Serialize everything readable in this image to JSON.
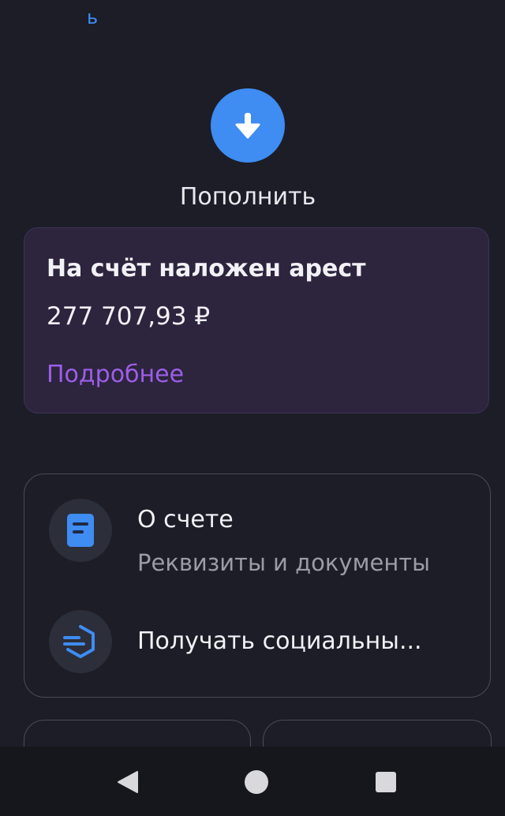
{
  "header": {
    "fragment_text": "ь"
  },
  "topup": {
    "icon": "arrow-down-icon",
    "label": "Пополнить",
    "accent_color": "#3f8cf2"
  },
  "arrest_notice": {
    "title": "На счёт наложен арест",
    "amount": "277 707,93 ₽",
    "link_label": "Подробнее",
    "link_color": "#9d5ee8"
  },
  "account_menu": {
    "items": [
      {
        "icon": "document-icon",
        "title": "О счете",
        "subtitle": "Реквизиты и документы"
      },
      {
        "icon": "social-payments-icon",
        "title": "Получать социальны..."
      }
    ]
  },
  "system_nav": {
    "back_icon": "back-triangle-icon",
    "home_icon": "home-circle-icon",
    "recents_icon": "recents-square-icon"
  }
}
